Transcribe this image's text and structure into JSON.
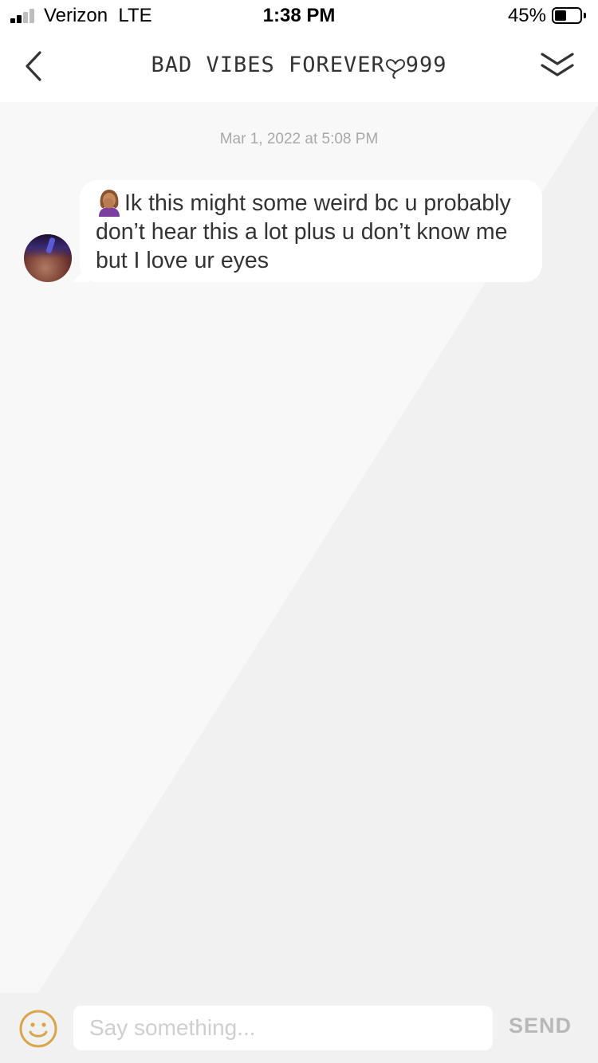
{
  "status_bar": {
    "carrier": "Verizon  LTE",
    "time": "1:38 PM",
    "battery_percent": "45%",
    "battery_level": 0.45,
    "signal_bars_active": 2,
    "signal_bars_total": 4
  },
  "header": {
    "title": "BAD VIBES FOREVER",
    "title_suffix": "999",
    "back_icon": "chevron-left-icon",
    "collapse_icon": "double-chevron-down-icon"
  },
  "chat": {
    "timestamp": "Mar 1, 2022 at 5:08 PM",
    "messages": [
      {
        "sender_avatar": "avatar",
        "emoji": "woman-facepalming-emoji",
        "text": "Ik this might some weird bc u probably don’t hear this a lot plus u don’t know me but I love ur eyes"
      }
    ]
  },
  "composer": {
    "placeholder": "Say something...",
    "value": "",
    "send_label": "SEND",
    "emoji_icon": "smiley-icon"
  },
  "colors": {
    "accent_smiley": "#d9a54a",
    "chat_bg": "#f1f1f1",
    "bubble_bg": "#ffffff",
    "text": "#333333",
    "timestamp": "#a9a9a9",
    "send_disabled": "#b8b8b8"
  }
}
